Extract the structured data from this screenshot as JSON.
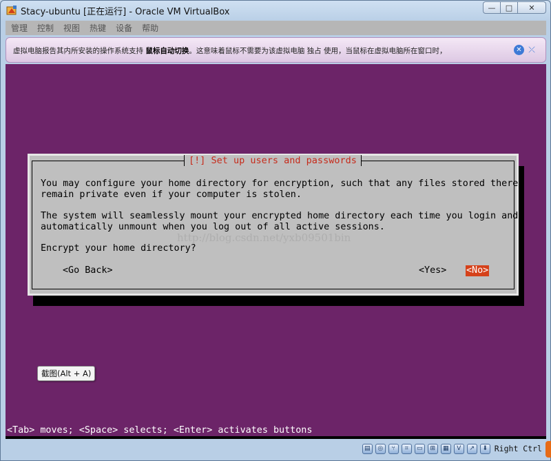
{
  "window": {
    "title": "Stacy-ubuntu [正在运行] - Oracle VM VirtualBox",
    "controls": {
      "minimize": "—",
      "restore": "□",
      "close": "✕"
    }
  },
  "menu": [
    "管理",
    "控制",
    "视图",
    "热键",
    "设备",
    "帮助"
  ],
  "notice": {
    "text_before": "虚拟电脑报告其内所安装的操作系统支持 ",
    "text_bold": "鼠标自动切换",
    "text_after": "。这意味着鼠标不需要为该虚拟电脑 独占 使用，当鼠标在虚拟电脑所在窗口时，"
  },
  "dialog": {
    "title": "[!] Set up users and passwords",
    "paragraph1": [
      "You may configure your home directory for encryption, such that any files stored there",
      "remain private even if your computer is stolen."
    ],
    "paragraph2": [
      "The system will seamlessly mount your encrypted home directory each time you login and",
      "automatically unmount when you log out of all active sessions."
    ],
    "question": "Encrypt your home directory?",
    "go_back": "<Go Back>",
    "yes": "<Yes>",
    "no": "<No>"
  },
  "watermark": "http://blog.csdn.net/yxb09501bin",
  "screenshot_tooltip": "截图(Alt + A)",
  "help_line": "<Tab> moves; <Space> selects; <Enter> activates buttons",
  "status": {
    "host_key": "Right Ctrl",
    "icons": [
      "hard-disk-icon",
      "optical-disk-icon",
      "usb-icon",
      "shared-folder-icon",
      "display-icon",
      "network-icon",
      "recording-icon",
      "cpu-virtualization-icon",
      "mouse-integration-icon",
      "keyboard-capture-icon"
    ]
  },
  "colors": {
    "console_background": "#6c2468",
    "dialog_background": "#bfbfbf",
    "title_text": "#c62a1a",
    "selected_button": "#d5411a"
  }
}
